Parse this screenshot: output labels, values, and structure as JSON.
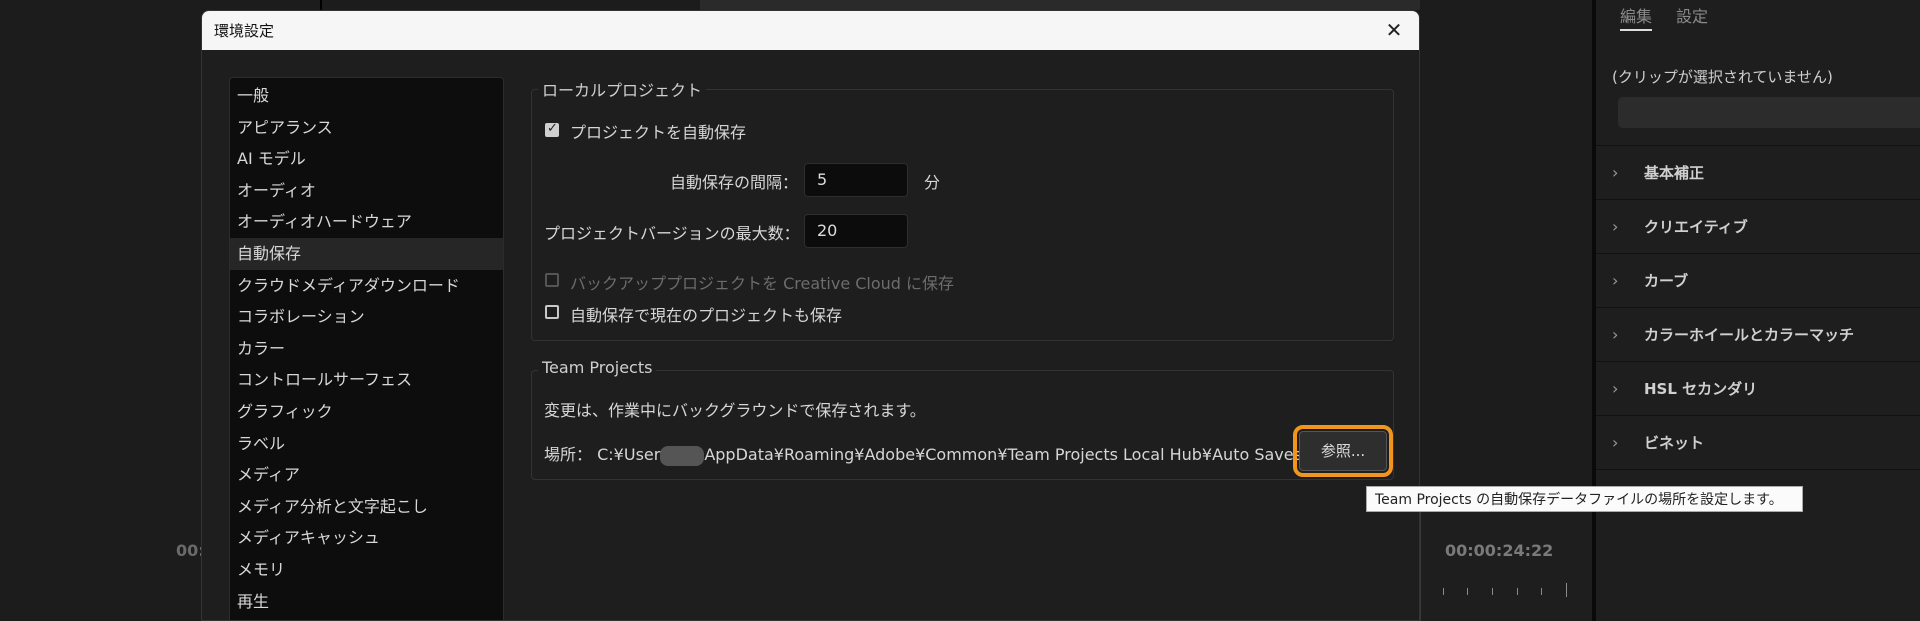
{
  "background": {
    "timecode_left": "00:",
    "timecode_right": "00:00:24:22"
  },
  "dialog": {
    "title": "環境設定",
    "close_icon": "close-icon",
    "nav": [
      "一般",
      "アピアランス",
      "AI モデル",
      "オーディオ",
      "オーディオハードウェア",
      "自動保存",
      "クラウドメディアダウンロード",
      "コラボレーション",
      "カラー",
      "コントロールサーフェス",
      "グラフィック",
      "ラベル",
      "メディア",
      "メディア分析と文字起こし",
      "メディアキャッシュ",
      "メモリ",
      "再生"
    ],
    "selected_nav": "自動保存",
    "local": {
      "title": "ローカルプロジェクト",
      "autosave_label": "プロジェクトを自動保存",
      "autosave_checked": true,
      "interval_label": "自動保存の間隔：",
      "interval_value": "5",
      "interval_unit": "分",
      "versions_label": "プロジェクトバージョンの最大数：",
      "versions_value": "20",
      "backup_label": "バックアッププロジェクトを Creative Cloud に保存",
      "backup_checked": false,
      "current_label": "自動保存で現在のプロジェクトも保存",
      "current_checked": false
    },
    "team": {
      "title": "Team Projects",
      "desc": "変更は、作業中にバックグラウンドで保存されます。",
      "location_label": "場所：",
      "path_start": "C:¥User",
      "path_end": "AppData¥Roaming¥Adobe¥Common¥Team Projects Local Hub¥Auto Saves",
      "browse_label": "参照...",
      "tooltip": "Team Projects の自動保存データファイルの場所を設定します。",
      "highlight_color": "#f0961e"
    }
  },
  "right_panel": {
    "tabs": [
      "編集",
      "設定"
    ],
    "no_clip": "(クリップが選択されていません)",
    "sections": [
      "基本補正",
      "クリエイティブ",
      "カーブ",
      "カラーホイールとカラーマッチ",
      "HSL セカンダリ",
      "ビネット"
    ]
  }
}
